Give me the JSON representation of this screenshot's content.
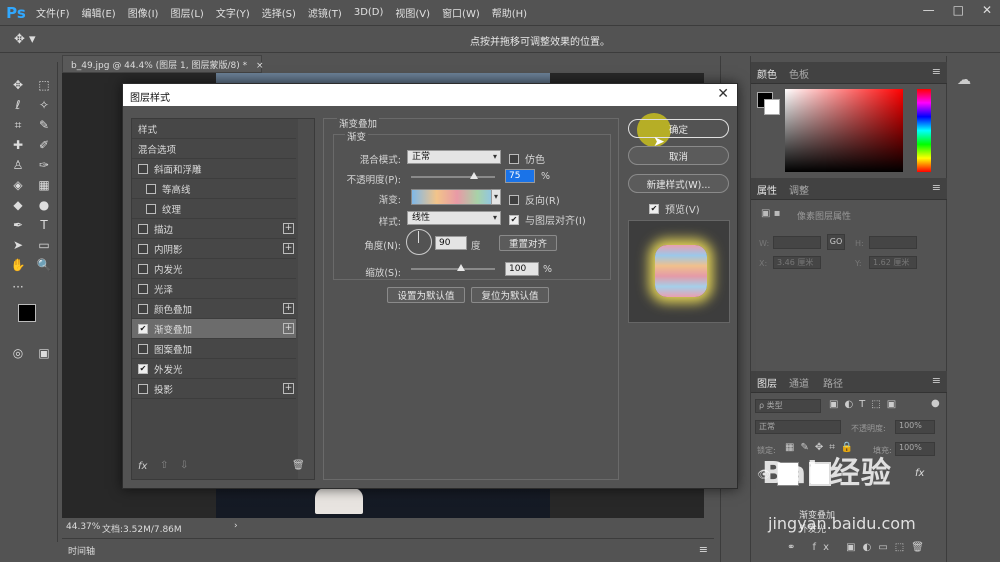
{
  "app": {
    "logo": "Ps"
  },
  "menu": [
    "文件(F)",
    "编辑(E)",
    "图像(I)",
    "图层(L)",
    "文字(Y)",
    "选择(S)",
    "滤镜(T)",
    "3D(D)",
    "视图(V)",
    "窗口(W)",
    "帮助(H)"
  ],
  "window_controls": {
    "minimize": "—",
    "maximize": "□",
    "close": "✕"
  },
  "options_bar": {
    "hint": "点按并拖移可调整效果的位置。"
  },
  "document": {
    "tab_title": "b_49.jpg @ 44.4% (图层 1, 图层蒙版/8) *",
    "tab_close": "×",
    "zoom": "44.37%",
    "doc_size": "文档:3.52M/7.86M",
    "status_arrow": "›"
  },
  "timeline": {
    "label": "时间轴"
  },
  "panels": {
    "color_tabs": [
      "颜色",
      "色板"
    ],
    "properties_tabs": [
      "属性",
      "调整"
    ],
    "properties_title": "像素图层属性",
    "prop_fields": {
      "w": "W:",
      "h": "H:",
      "x": "X:",
      "y": "Y:",
      "x_val": "3.46 厘米",
      "y_val": "1.62 厘米",
      "go": "GO"
    },
    "layers_tabs": [
      "图层",
      "通道",
      "路径"
    ],
    "layers_filter": "ρ 类型",
    "blend_mode": "正常",
    "opacity_label": "不透明度:",
    "opacity_value": "100%",
    "lock_label": "锁定:",
    "fill_label": "填充:",
    "fill_value": "100%",
    "layer_fx": "fx",
    "effect_item": "渐变叠加",
    "effect_item2": "外发光",
    "menu_icon": "≡"
  },
  "dialog": {
    "title": "图层样式",
    "close": "✕",
    "styles_list": [
      {
        "label": "样式",
        "checkbox": false,
        "checked": false,
        "plus": false,
        "selected": false
      },
      {
        "label": "混合选项",
        "checkbox": false,
        "checked": false,
        "plus": false,
        "selected": false
      },
      {
        "label": "斜面和浮雕",
        "checkbox": true,
        "checked": false,
        "plus": false,
        "selected": false
      },
      {
        "label": "等高线",
        "checkbox": true,
        "checked": false,
        "plus": false,
        "selected": false,
        "indent": true
      },
      {
        "label": "纹理",
        "checkbox": true,
        "checked": false,
        "plus": false,
        "selected": false,
        "indent": true
      },
      {
        "label": "描边",
        "checkbox": true,
        "checked": false,
        "plus": true,
        "selected": false
      },
      {
        "label": "内阴影",
        "checkbox": true,
        "checked": false,
        "plus": true,
        "selected": false
      },
      {
        "label": "内发光",
        "checkbox": true,
        "checked": false,
        "plus": false,
        "selected": false
      },
      {
        "label": "光泽",
        "checkbox": true,
        "checked": false,
        "plus": false,
        "selected": false
      },
      {
        "label": "颜色叠加",
        "checkbox": true,
        "checked": false,
        "plus": true,
        "selected": false
      },
      {
        "label": "渐变叠加",
        "checkbox": true,
        "checked": true,
        "plus": true,
        "selected": true
      },
      {
        "label": "图案叠加",
        "checkbox": true,
        "checked": false,
        "plus": false,
        "selected": false
      },
      {
        "label": "外发光",
        "checkbox": true,
        "checked": true,
        "plus": false,
        "selected": false
      },
      {
        "label": "投影",
        "checkbox": true,
        "checked": false,
        "plus": true,
        "selected": false
      }
    ],
    "list_footer": {
      "fx": "fx",
      "up": "⇧",
      "down": "⇩",
      "trash": "🗑"
    },
    "section_title": "渐变叠加",
    "sub_section_title": "渐变",
    "blend_mode_label": "混合模式:",
    "blend_mode_value": "正常",
    "dither_label": "仿色",
    "opacity_label": "不透明度(P):",
    "opacity_value": "75",
    "percent": "%",
    "gradient_label": "渐变:",
    "reverse_label": "反向(R)",
    "style_label": "样式:",
    "style_value": "线性",
    "align_label": "与图层对齐(I)",
    "angle_label": "角度(N):",
    "angle_value": "90",
    "degree": "度",
    "reset_align": "重置对齐",
    "scale_label": "缩放(S):",
    "scale_value": "100",
    "set_default": "设置为默认值",
    "reset_default": "复位为默认值",
    "ok": "确定",
    "cancel": "取消",
    "new_style": "新建样式(W)...",
    "preview_label": "预览(V)"
  },
  "opacity_slider_fraction": 0.75,
  "scale_slider_fraction": 0.6,
  "watermark": {
    "logo": "Bai 经验",
    "sub": "jingyan.baidu.com"
  }
}
